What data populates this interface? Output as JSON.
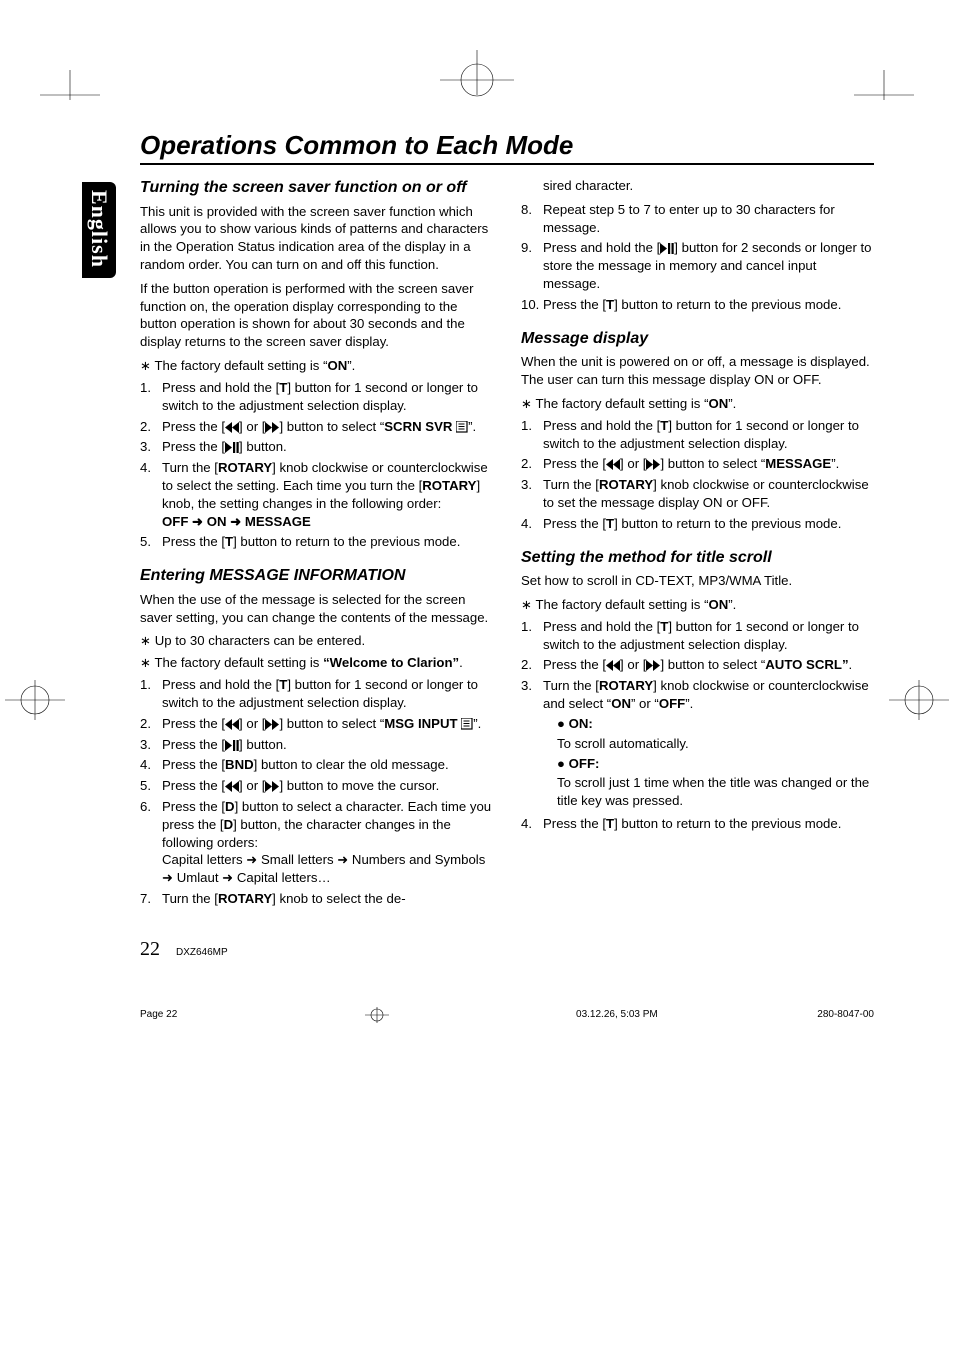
{
  "sideTab": "English",
  "sectionTitle": "Operations Common to Each Mode",
  "left": {
    "h_screenSaver": "Turning the screen saver function on or off",
    "p_ss1": "This unit is provided with the screen saver function which allows you to show various kinds of patterns and characters in the Operation Status indication area of the display in a random order. You can turn on and off this function.",
    "p_ss2": "If the button operation is performed with the screen saver function on, the operation display corresponding to the button operation is shown for about 30 seconds and the display returns to the screen saver display.",
    "note_ss": "∗ The factory default setting is “",
    "note_ss_bold": "ON",
    "note_ss_end": "”.",
    "ss_steps": [
      {
        "n": "1.",
        "t_pre": "Press and hold the [",
        "t_btn": "T",
        "t_post": "] button for 1 second or longer to switch to the adjustment selection display."
      },
      {
        "n": "2.",
        "t_pre": "Press the [",
        "t_post": "] button to select “",
        "t_bold": "SCRN SVR ",
        "t_end": "”.",
        "two_icons": true,
        "trailing_icon": "list"
      },
      {
        "n": "3.",
        "t_pre": "Press the [",
        "t_post": "] button.",
        "icon": "playpause"
      },
      {
        "n": "4.",
        "t_pre": "Turn the [",
        "t_btn": "ROTARY",
        "t_mid": "] knob clockwise or counterclockwise to select the setting. Each time you turn the [",
        "t_btn2": "ROTARY",
        "t_post2": "] knob, the setting changes in the following order:",
        "seq": "OFF ➜ ON ➜ MESSAGE"
      },
      {
        "n": "5.",
        "t_pre": "Press the [",
        "t_btn": "T",
        "t_post": "] button to return to the previous mode."
      }
    ],
    "h_msgInfo": "Entering MESSAGE INFORMATION",
    "p_msgInfo": "When the use of the message is selected for the screen saver setting, you can change the contents of the message.",
    "note_msg1": "∗ Up to 30 characters can be entered.",
    "note_msg2_pre": "∗ The factory default setting is ",
    "note_msg2_bold": "“Welcome to Clarion”",
    "note_msg2_end": ".",
    "msg_steps": [
      {
        "n": "1.",
        "t_pre": "Press and hold the [",
        "t_btn": "T",
        "t_post": "] button for 1 second or longer to switch to the adjustment selection display."
      },
      {
        "n": "2.",
        "t_pre": "Press the [",
        "t_post": "] button to select “",
        "t_bold": "MSG INPUT ",
        "t_end": "”.",
        "two_icons": true,
        "trailing_icon": "list"
      },
      {
        "n": "3.",
        "t_pre": "Press the [",
        "t_post": "] button.",
        "icon": "playpause"
      },
      {
        "n": "4.",
        "t_pre": "Press the [",
        "t_btn": "BND",
        "t_post": "] button to clear the old message."
      },
      {
        "n": "5.",
        "t_pre": "Press the [",
        "t_post": "] button to move the cursor.",
        "two_icons": true
      },
      {
        "n": "6.",
        "t_pre": "Press the [",
        "t_btn": "D",
        "t_mid": "] button to select a character. Each time you press the [",
        "t_btn2": "D",
        "t_post2": "] button, the character changes in the following orders:",
        "seq2": "Capital letters ➜ Small letters ➜ Numbers and Symbols ➜ Umlaut ➜ Capital letters…"
      },
      {
        "n": "7.",
        "t_pre": "Turn the [",
        "t_btn": "ROTARY",
        "t_post": "] knob to select the de-"
      }
    ]
  },
  "right": {
    "cont7": "sired character.",
    "steps_cont": [
      {
        "n": "8.",
        "t": "Repeat step 5 to 7 to enter up to 30 characters for message."
      },
      {
        "n": "9.",
        "t_pre": "Press and hold the [",
        "t_post": "] button for 2 seconds or longer to store the message in memory and cancel input message.",
        "icon": "playpause"
      },
      {
        "n": "10.",
        "t_pre": "Press the [",
        "t_btn": "T",
        "t_post": "] button to return to the previous mode."
      }
    ],
    "h_msgDisp": "Message display",
    "p_msgDisp": "When the unit is powered on or off, a message is displayed. The user can turn this message display ON or OFF.",
    "note_md": "∗ The factory default setting is “",
    "note_md_bold": "ON",
    "note_md_end": "”.",
    "md_steps": [
      {
        "n": "1.",
        "t_pre": "Press and hold the [",
        "t_btn": "T",
        "t_post": "] button for 1 second or longer to switch to the adjustment selection display."
      },
      {
        "n": "2.",
        "t_pre": "Press the [",
        "t_post": "] button to select “",
        "t_bold": "MESSAGE",
        "t_end": "”.",
        "two_icons": true
      },
      {
        "n": "3.",
        "t_pre": "Turn the [",
        "t_btn": "ROTARY",
        "t_post": "] knob clockwise or counterclockwise to set the message display ON or OFF."
      },
      {
        "n": "4.",
        "t_pre": "Press the [",
        "t_btn": "T",
        "t_post": "] button to return to the previous mode."
      }
    ],
    "h_scroll": "Setting the method for title scroll",
    "p_scroll": "Set how to scroll in CD-TEXT, MP3/WMA Title.",
    "note_sc": "∗ The factory default setting is “",
    "note_sc_bold": "ON",
    "note_sc_end": "”.",
    "sc_steps": [
      {
        "n": "1.",
        "t_pre": "Press and hold the [",
        "t_btn": "T",
        "t_post": "] button for 1 second or longer to switch to the adjustment selection display."
      },
      {
        "n": "2.",
        "t_pre": "Press the [",
        "t_post": "] button to select “",
        "t_bold": "AUTO SCRL”",
        "t_end": ".",
        "two_icons": true
      },
      {
        "n": "3.",
        "t_pre": "Turn the [",
        "t_btn": "ROTARY",
        "t_mid": "] knob clockwise or counterclockwise and select “",
        "t_btn2": "ON",
        "t_mid2": "” or “",
        "t_btn3": "OFF",
        "t_post3": "”.",
        "sub": [
          {
            "label": "● ON:",
            "desc": "To scroll automatically."
          },
          {
            "label": "● OFF:",
            "desc": "To scroll just 1 time when the title was changed or the title key was pressed."
          }
        ]
      },
      {
        "n": "4.",
        "t_pre": "Press the [",
        "t_btn": "T",
        "t_post": "] button to return to the previous mode."
      }
    ]
  },
  "footer": {
    "pageNum": "22",
    "model": "DXZ646MP",
    "footLeft": "Page 22",
    "footMid": "03.12.26, 5:03 PM",
    "footRight": "280-8047-00"
  }
}
